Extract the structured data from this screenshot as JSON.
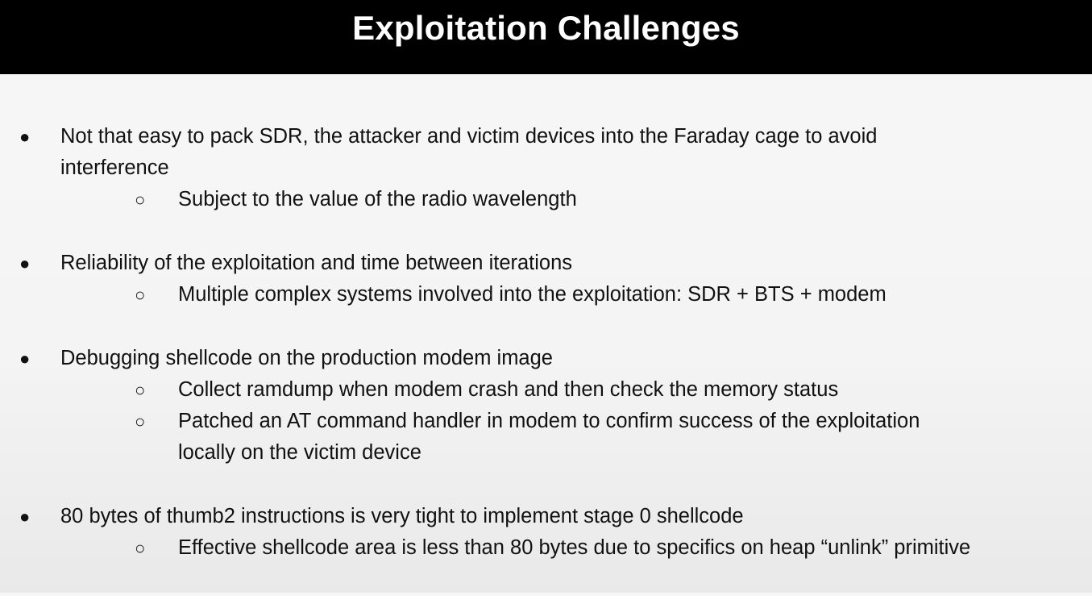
{
  "slide": {
    "title": "Exploitation Challenges",
    "bullet_marker": "●",
    "sub_bullet_marker": "○",
    "bullets": [
      {
        "lines": [
          "Not that easy to pack SDR, the attacker and victim devices into the Faraday cage to avoid",
          "interference"
        ],
        "sub_bullets": [
          {
            "lines": [
              "Subject to the value of the radio wavelength"
            ]
          }
        ]
      },
      {
        "lines": [
          "Reliability of the exploitation and time between iterations"
        ],
        "sub_bullets": [
          {
            "lines": [
              "Multiple complex systems involved into the exploitation: SDR + BTS + modem"
            ]
          }
        ]
      },
      {
        "lines": [
          "Debugging shellcode on the production modem image"
        ],
        "sub_bullets": [
          {
            "lines": [
              "Collect ramdump when modem crash and then check the memory status"
            ]
          },
          {
            "lines": [
              "Patched an AT command handler in modem to confirm success of the exploitation",
              "locally on the victim device"
            ]
          }
        ]
      },
      {
        "lines": [
          "80 bytes of thumb2 instructions is very tight to implement stage 0 shellcode"
        ],
        "sub_bullets": [
          {
            "lines": [
              "Effective shellcode area is less than 80 bytes due to specifics on heap “unlink” primitive"
            ]
          }
        ]
      }
    ]
  }
}
